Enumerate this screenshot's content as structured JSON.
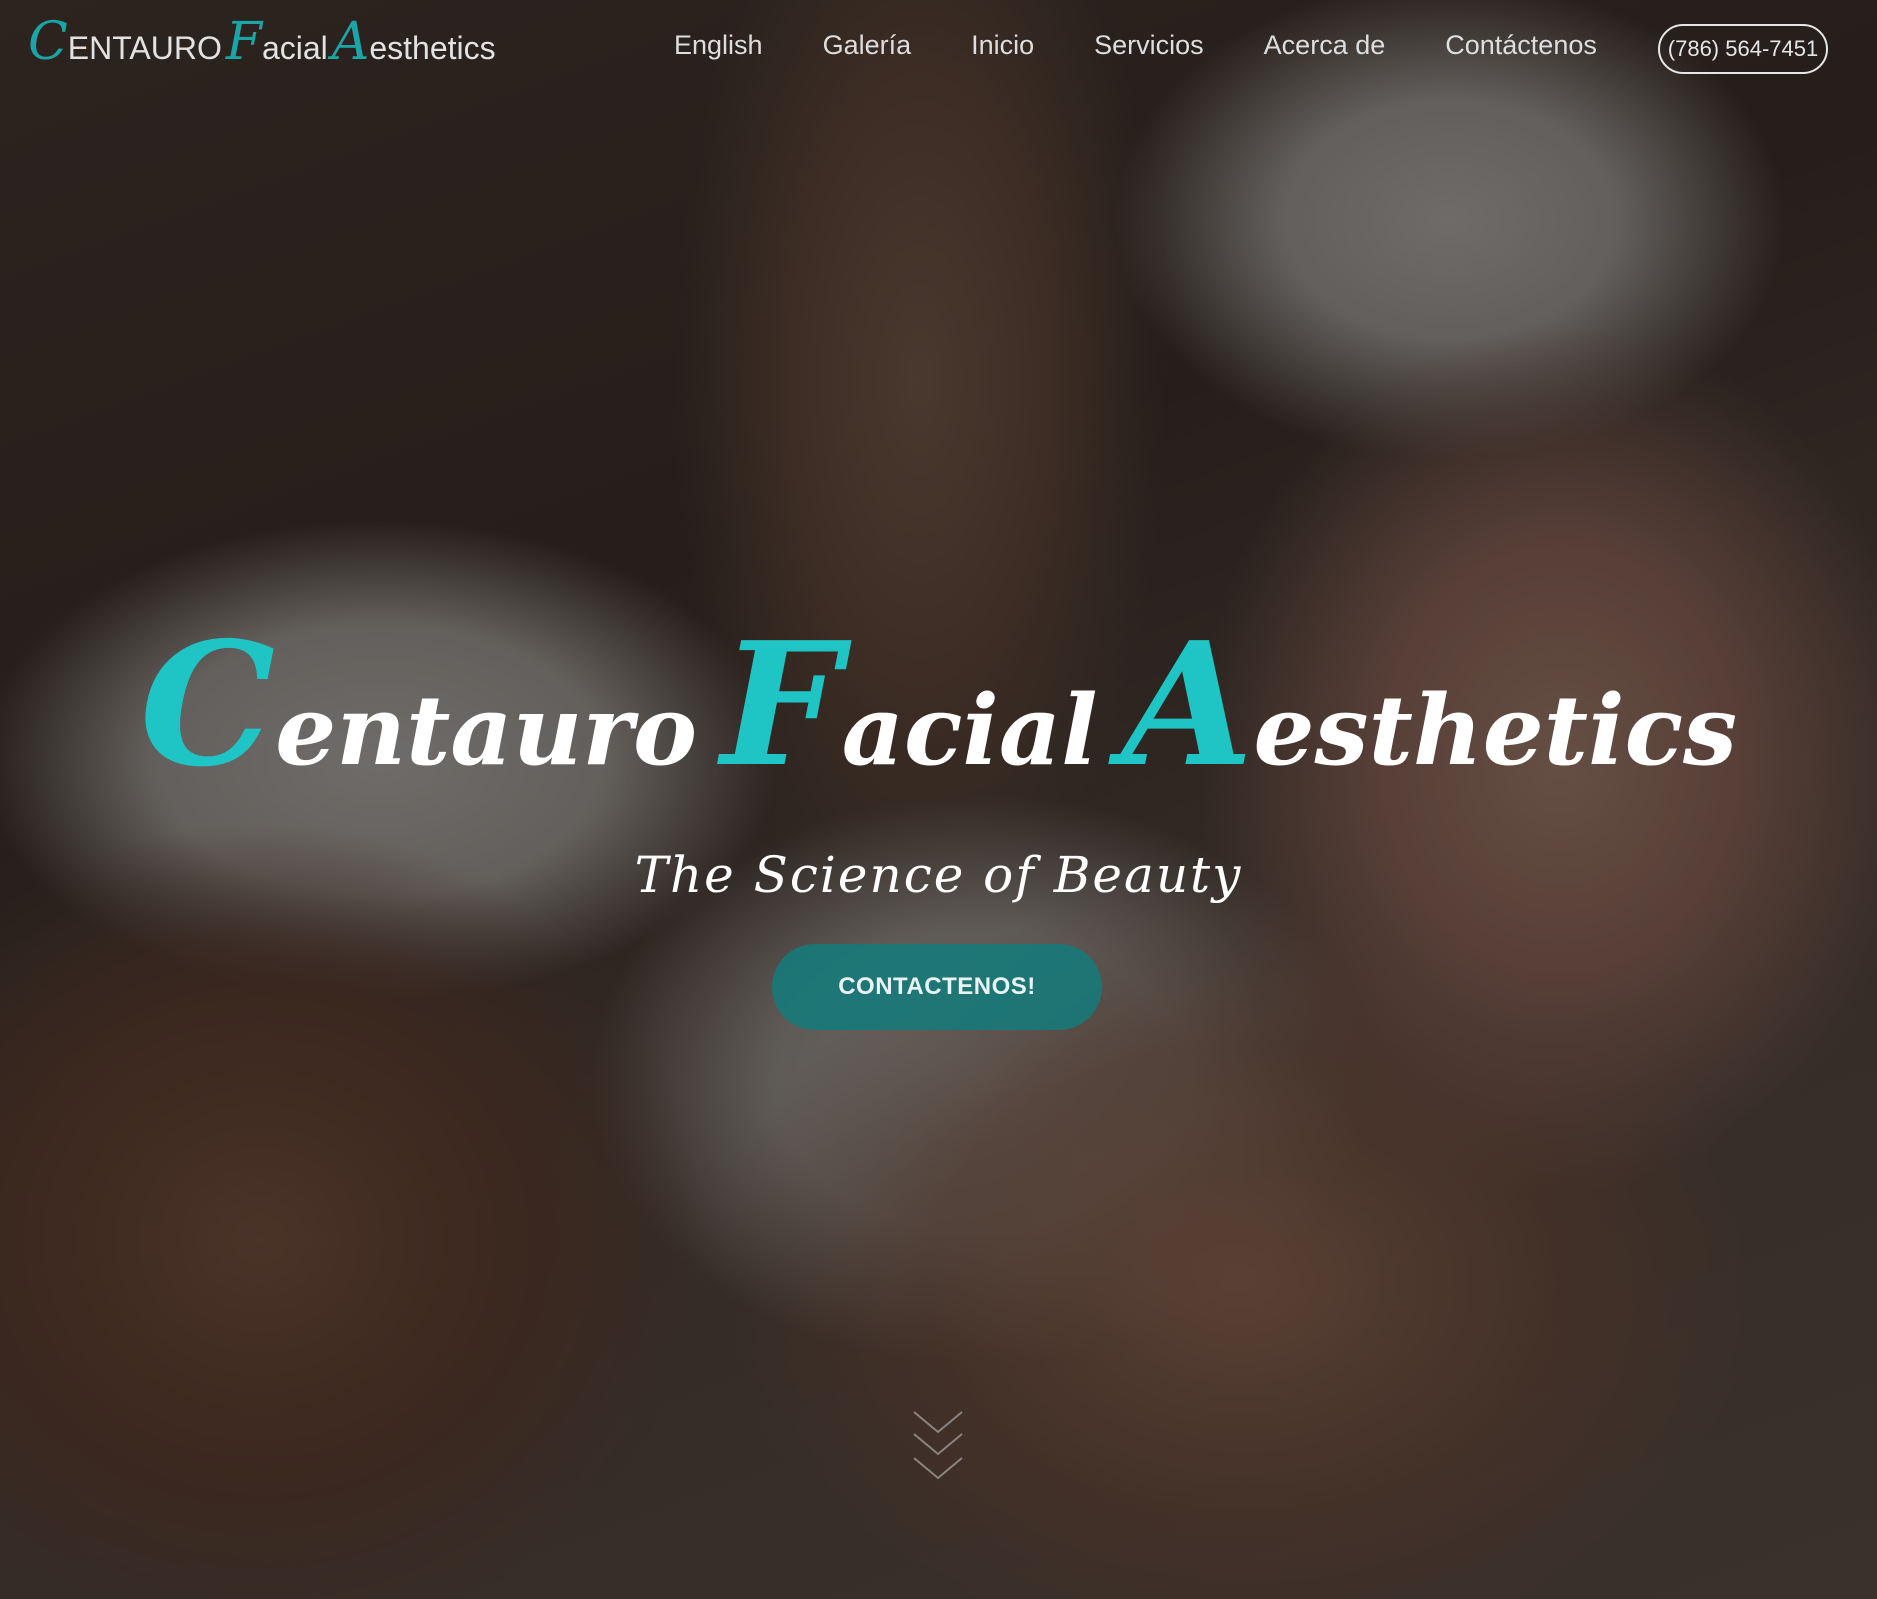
{
  "logo": {
    "c_cap": "C",
    "c_rest": "ENTAURO",
    "f_cap": "F",
    "f_rest": "acial",
    "a_cap": "A",
    "a_rest": "esthetics"
  },
  "nav": {
    "items": [
      "English",
      "Galería",
      "Inicio",
      "Servicios",
      "Acerca de",
      "Contáctenos"
    ]
  },
  "phone": "(786) 564-7451",
  "hero": {
    "c_cap": "C",
    "c_rest": "entauro",
    "f_cap": "F",
    "f_rest": "acial",
    "a_cap": "A",
    "a_rest": "esthetics",
    "tagline": "The Science of Beauty",
    "cta_label": "CONTACTENOS!"
  },
  "icons": {
    "scroll": "double-chevron-down-icon"
  },
  "colors": {
    "accent": "#1fc4c4",
    "logo_accent": "#1aa6a6",
    "cta_bg": "#167a7a",
    "text_light": "#ffffff"
  }
}
